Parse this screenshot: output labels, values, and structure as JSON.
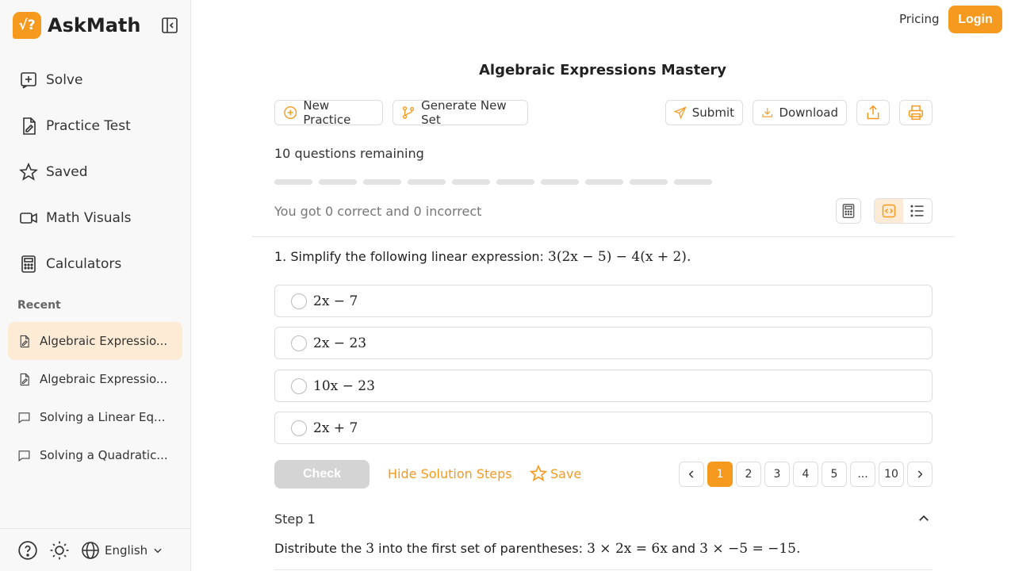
{
  "brand": {
    "name": "AskMath",
    "logo_glyph": "√?"
  },
  "nav": [
    {
      "label": "Solve",
      "icon": "plus-square-icon"
    },
    {
      "label": "Practice Test",
      "icon": "document-icon"
    },
    {
      "label": "Saved",
      "icon": "star-icon"
    },
    {
      "label": "Math Visuals",
      "icon": "video-icon"
    },
    {
      "label": "Calculators",
      "icon": "calculator-icon"
    }
  ],
  "recent": {
    "title": "Recent",
    "items": [
      {
        "label": "Algebraic Expressio...",
        "icon": "document-icon"
      },
      {
        "label": "Algebraic Expressio...",
        "icon": "document-icon"
      },
      {
        "label": "Solving a Linear Eq...",
        "icon": "chat-icon"
      },
      {
        "label": "Solving a Quadratic...",
        "icon": "chat-icon"
      }
    ]
  },
  "footer": {
    "language": "English"
  },
  "header": {
    "pricing": "Pricing",
    "login": "Login"
  },
  "page": {
    "title": "Algebraic Expressions Mastery",
    "toolbar": {
      "new_practice": "New Practice",
      "generate": "Generate New Set",
      "submit": "Submit",
      "download": "Download"
    },
    "remaining": "10 questions remaining",
    "progress_segments": 10,
    "score": "You got 0 correct and 0 incorrect"
  },
  "question": {
    "number": "1.",
    "text": "Simplify the following linear expression:",
    "expression": "3(2x − 5) − 4(x + 2).",
    "options": [
      "2x − 7",
      "2x − 23",
      "10x − 23",
      "2x + 7"
    ]
  },
  "actions": {
    "check": "Check",
    "hide_steps": "Hide Solution Steps",
    "save": "Save"
  },
  "pager": {
    "pages": [
      "1",
      "2",
      "3",
      "4",
      "5",
      "...",
      "10"
    ],
    "current": "1"
  },
  "step": {
    "title": "Step 1",
    "text_pre": "Distribute the",
    "text_num": "3",
    "text_mid": "into the first set of parentheses:",
    "expr1": "3 × 2x = 6x",
    "text_and": "and",
    "expr2": "3 × −5 = −15."
  },
  "colors": {
    "accent": "#f59a1f",
    "accent_light": "#fdebd6"
  }
}
